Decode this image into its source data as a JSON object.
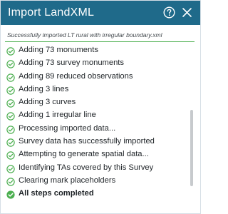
{
  "dialog": {
    "title": "Import LandXML",
    "help_icon": "question-circle-icon",
    "close_icon": "close-icon",
    "status_message": "Successfully imported LT rural with irregular boundary.xml",
    "accent_color": "#1f6a8a",
    "success_color": "#4caf50"
  },
  "steps": [
    {
      "label": "Adding 73 monuments",
      "icon": "check-circle-outline-icon"
    },
    {
      "label": "Adding 73 survey monuments",
      "icon": "check-circle-outline-icon"
    },
    {
      "label": "Adding 89 reduced observations",
      "icon": "check-circle-outline-icon"
    },
    {
      "label": "Adding 3 lines",
      "icon": "check-circle-outline-icon"
    },
    {
      "label": "Adding 3 curves",
      "icon": "check-circle-outline-icon"
    },
    {
      "label": "Adding 1 irregular line",
      "icon": "check-circle-outline-icon"
    },
    {
      "label": "Processing imported data...",
      "icon": "check-circle-outline-icon"
    },
    {
      "label": "Survey data has successfully imported",
      "icon": "check-circle-outline-icon"
    },
    {
      "label": "Attempting to generate spatial data...",
      "icon": "check-circle-outline-icon"
    },
    {
      "label": "Identifying TAs covered by this Survey",
      "icon": "check-circle-outline-icon"
    },
    {
      "label": "Clearing mark placeholders",
      "icon": "check-circle-outline-icon"
    },
    {
      "label": "All steps completed",
      "icon": "check-circle-filled-icon"
    }
  ]
}
